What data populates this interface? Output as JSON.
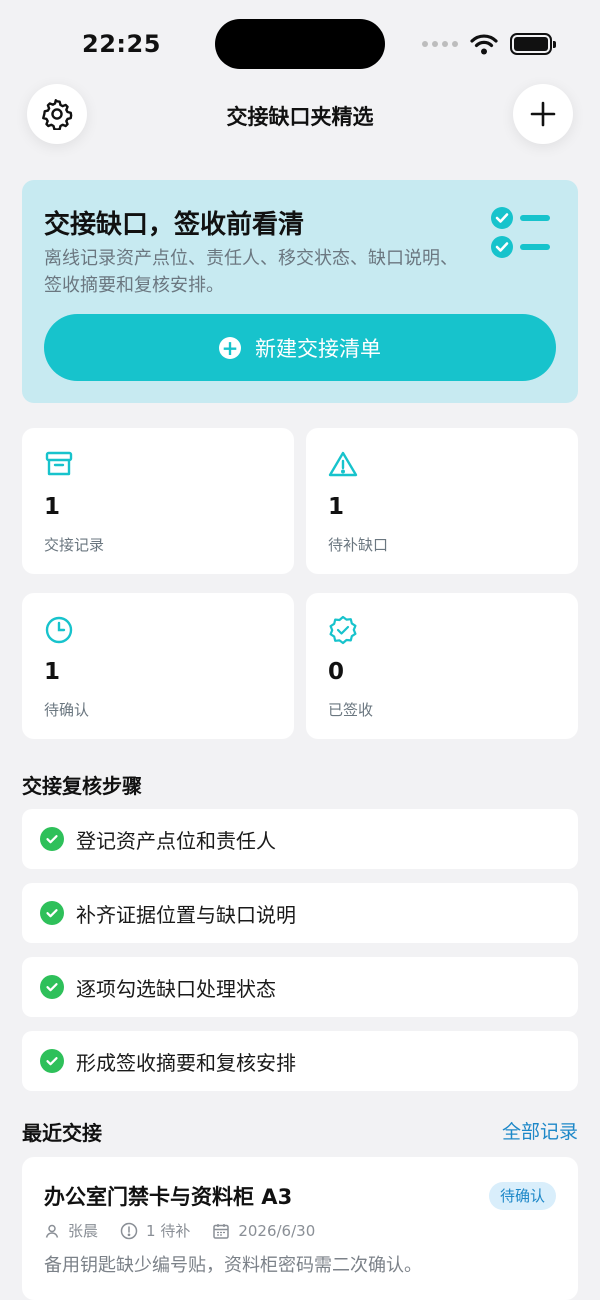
{
  "status_bar": {
    "time": "22:25"
  },
  "nav": {
    "title": "交接缺口夹精选"
  },
  "hero": {
    "title": "交接缺口，签收前看清",
    "description": "离线记录资产点位、责任人、移交状态、缺口说明、签收摘要和复核安排。",
    "cta_label": "新建交接清单"
  },
  "stats": [
    {
      "value": "1",
      "label": "交接记录",
      "icon": "archive-icon"
    },
    {
      "value": "1",
      "label": "待补缺口",
      "icon": "warning-icon"
    },
    {
      "value": "1",
      "label": "待确认",
      "icon": "clock-icon"
    },
    {
      "value": "0",
      "label": "已签收",
      "icon": "badge-check-icon"
    }
  ],
  "steps_section": {
    "title": "交接复核步骤",
    "items": [
      "登记资产点位和责任人",
      "补齐证据位置与缺口说明",
      "逐项勾选缺口处理状态",
      "形成签收摘要和复核安排"
    ]
  },
  "recent_section": {
    "title": "最近交接",
    "all_link": "全部记录",
    "items": [
      {
        "title": "办公室门禁卡与资料柜 A3",
        "status": "待确认",
        "person": "张晨",
        "pending": "1 待补",
        "date": "2026/6/30",
        "note": "备用钥匙缺少编号贴，资料柜密码需二次确认。"
      }
    ]
  },
  "colors": {
    "accent": "#17c3cc",
    "hero_bg": "#c7eaf1",
    "success": "#2ec05a",
    "link": "#1e88c8",
    "page_bg": "#f2f2f4"
  }
}
